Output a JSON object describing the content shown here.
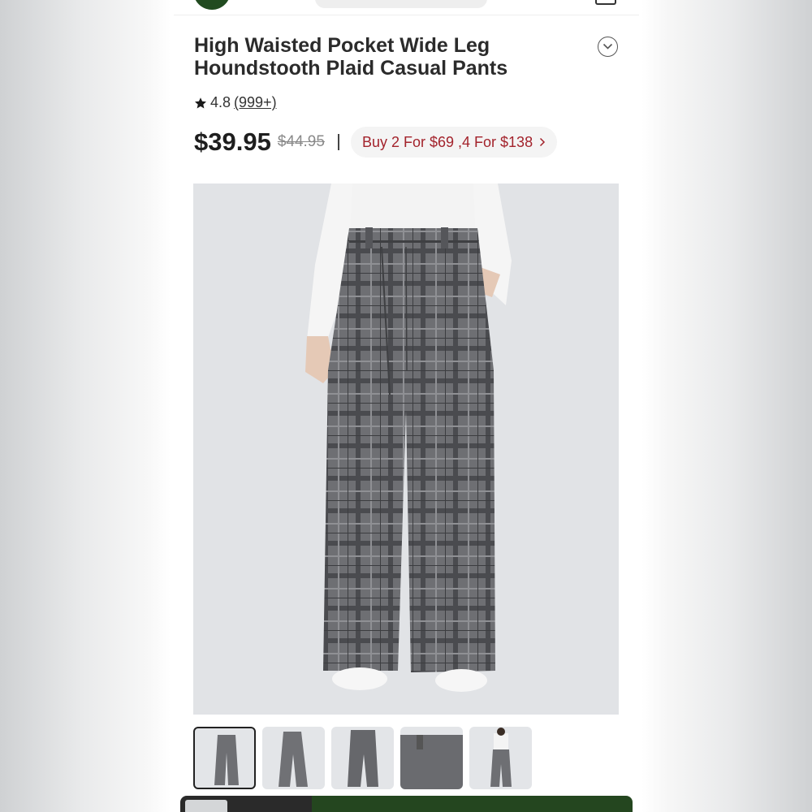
{
  "header": {
    "logo_icon": "brand-logo-icon",
    "search_icon": "search-bar-icon",
    "bag_icon": "shopping-bag-icon"
  },
  "product": {
    "title": "High Waisted Pocket Wide Leg Houndstooth Plaid Casual Pants",
    "rating": "4.8",
    "review_count": "(999+)",
    "price": "$39.95",
    "original_price": "$44.95",
    "separator": "|",
    "promo": "Buy 2 For $69 ,4 For $138",
    "promo_color": "#a3232c"
  },
  "gallery": {
    "selected_index": 0,
    "thumbnail_count": 5
  },
  "colors": {
    "brand_green": "#214b20",
    "image_bg": "#e1e3e6",
    "plaid_gray": "#6e6f73"
  }
}
